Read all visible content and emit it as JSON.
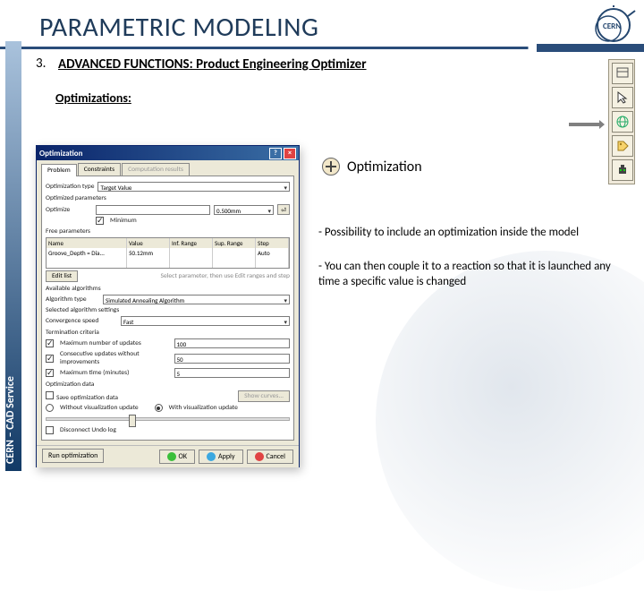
{
  "header": {
    "title": "PARAMETRIC MODELING"
  },
  "logo_name": "cern-logo",
  "side_label": "CERN – CAD Service",
  "section": {
    "number": "3.",
    "subtitle": "ADVANCED FUNCTIONS: Product Engineering Optimizer"
  },
  "optimizations_label": "Optimizations:",
  "feature": {
    "name": "Optimization",
    "bullets": [
      "- Possibility to include an optimization inside the model",
      "- You can then couple it to a reaction so that it is launched any time a specific value is changed"
    ]
  },
  "toolbox": {
    "items": [
      "panel-icon",
      "pointer-icon",
      "globe-icon",
      "tag-icon",
      "robot-icon"
    ]
  },
  "dialog": {
    "title": "Optimization",
    "tabs": [
      "Problem",
      "Constraints",
      "Computation results"
    ],
    "target_label": "Target Value",
    "params_group": "Optimized parameters",
    "optim_type_label": "Optimization type",
    "optim_type_value": "",
    "target_value": "0.500mm",
    "row2_label1": "Optimize",
    "row2_label2": "Minimum",
    "free_params": "Free parameters",
    "tbl_head": [
      "Name",
      "Value",
      "Inf. Range",
      "Sup. Range",
      "Step"
    ],
    "tbl_row": [
      "Groove_Depth = Dia...",
      "50.12mm",
      "",
      "",
      "Auto"
    ],
    "edit_list": "Edit list",
    "no_ranges": "Select parameter, then use Edit ranges and step",
    "algo_group": "Available algorithms",
    "algo_label": "Algorithm type",
    "algo_value": "Simulated Annealing Algorithm",
    "criteria_label": "Selected algorithm settings",
    "conv_label": "Convergence speed",
    "conv_value": "Fast",
    "term_group": "Termination criteria",
    "max_updates_label": "Maximum number of updates",
    "max_updates_value": "100",
    "consec_label": "Consecutive updates without improvements",
    "consec_value": "50",
    "max_time_label": "Maximum time (minutes)",
    "max_time_value": "5",
    "save_group": "Optimization data",
    "save_chk": "Save optimization data",
    "show_curves": "Show curves...",
    "vis_radio1": "Without visualization update",
    "vis_radio2": "With visualization update",
    "disconnect": "Disconnect Undo log",
    "run": "Run optimization",
    "ok": "OK",
    "apply": "Apply",
    "cancel": "Cancel"
  }
}
